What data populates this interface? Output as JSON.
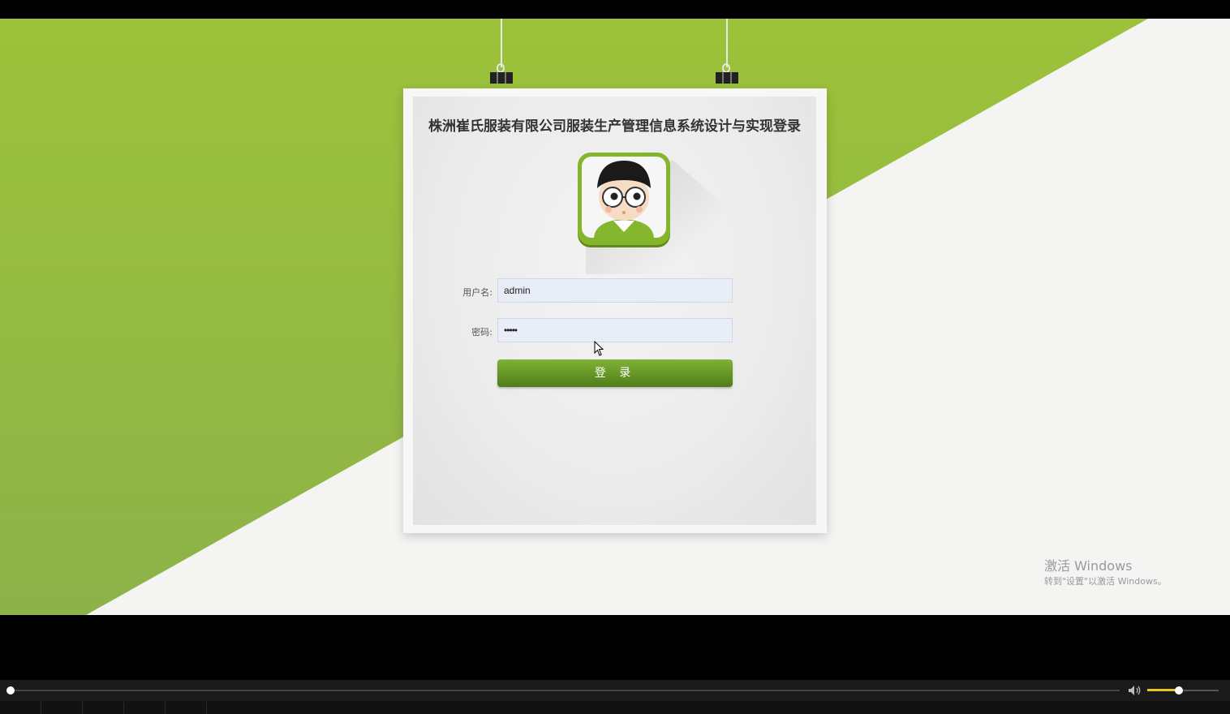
{
  "colors": {
    "accent_green": "#8ab93a",
    "button_green": "#5f8f22",
    "input_bg": "#e8edf7"
  },
  "login": {
    "title": "株洲崔氏服装有限公司服装生产管理信息系统设计与实现登录",
    "username_label": "用户名:",
    "username_value": "admin",
    "password_label": "密码:",
    "password_value": "•••••",
    "submit_label": "登 录"
  },
  "watermark": {
    "title": "激活 Windows",
    "subtitle": "转到\"设置\"以激活 Windows。"
  },
  "player": {
    "volume_level": 0.45,
    "progress": 0.0
  }
}
